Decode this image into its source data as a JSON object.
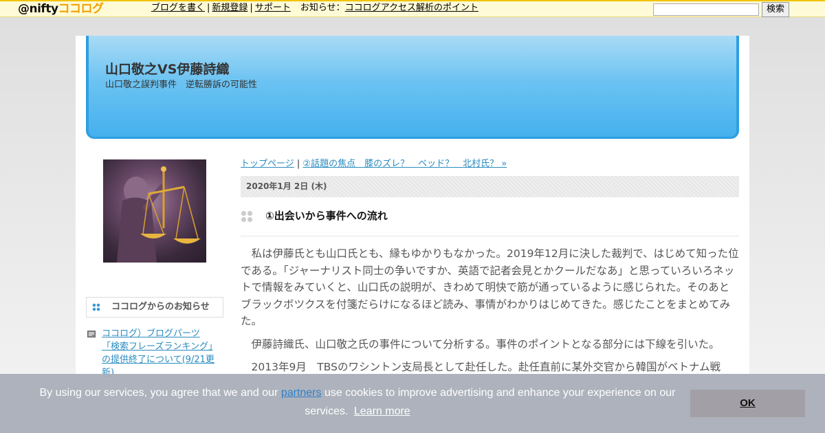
{
  "topbar": {
    "logo_prefix": "@nifty",
    "logo_suffix": "ココログ",
    "nav": [
      "ブログを書く",
      "新規登録",
      "サポート"
    ],
    "news_label": "お知らせ",
    "news_colon": "：",
    "news_link": "ココログアクセス解析のポイント",
    "search_placeholder": "",
    "search_button": "検索"
  },
  "header": {
    "title": "山口敬之VS伊藤詩織",
    "subtitle": "山口敬之誤判事件　逆転勝訴の可能性"
  },
  "sidebar": {
    "box_title": "ココログからのお知らせ",
    "items": [
      {
        "label": "ココログ）ブログパーツ「検索フレーズランキング」の提供終了について(9/21更新)"
      }
    ]
  },
  "content": {
    "breadcrumb_home": "トップページ",
    "breadcrumb_sep": "|",
    "breadcrumb_next": "②話題の焦点　膝のズレ？　ベッド？　北村氏？ »",
    "date": "2020年1月 2日 (木)",
    "post_title": "①出会いから事件への流れ",
    "paragraphs": [
      "私は伊藤氏とも山口氏とも、縁もゆかりもなかった。2019年12月に決した裁判で、はじめて知った位である。「ジャーナリスト同士の争いですか、英語で記者会見とかクールだなあ」と思っていろいろネットで情報をみていくと、山口氏の説明が、きわめて明快で筋が通っているように感じられた。そのあとブラックボツクスを付箋だらけになるほど読み、事情がわかりはじめてきた。感じたことをまとめてみた。",
      "伊藤詩織氏、山口敬之氏の事件について分析する。事件のポイントとなる部分には下線を引いた。",
      "2013年9月　TBSのワシントン支局長として赴任した。赴任直前に某外交官から韓国がベトナム戦"
    ]
  },
  "cookie": {
    "text_before": "By using our services, you agree that we and our ",
    "partners": "partners",
    "text_after": " use cookies to improve advertising and enhance your experience on our services.",
    "learn_more": "Learn more",
    "ok": "OK"
  },
  "colors": {
    "accent_link": "#2a8bc0",
    "banner_blue": "#45b0ee",
    "nifty_yellow": "#f0c400"
  }
}
